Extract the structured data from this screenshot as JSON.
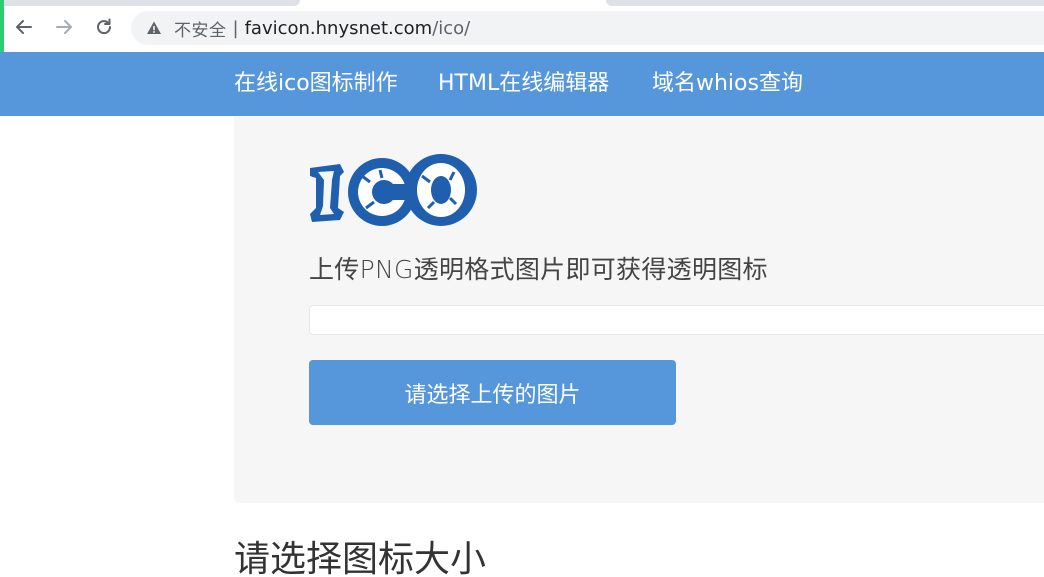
{
  "browser": {
    "security_label": "不安全",
    "separator": "|",
    "url_host": "favicon.hnysnet.com",
    "url_path": "/ico/"
  },
  "site_nav": {
    "items": [
      {
        "label": "在线ico图标制作"
      },
      {
        "label": "HTML在线编辑器"
      },
      {
        "label": "域名whios查询"
      }
    ]
  },
  "logo": {
    "text": "ICO"
  },
  "upload": {
    "hint": "上传PNG透明格式图片即可获得透明图标",
    "file_value": "",
    "button_label": "请选择上传的图片"
  },
  "size_section": {
    "heading": "请选择图标大小"
  },
  "colors": {
    "nav_bg": "#5697dc",
    "button_bg": "#5697dc",
    "panel_bg": "#f6f6f6",
    "logo_blue": "#1f5fae"
  }
}
